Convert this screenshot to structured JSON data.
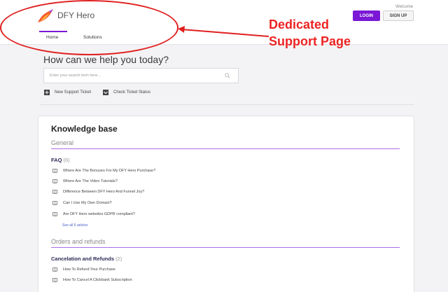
{
  "header": {
    "brand": "DFY Hero",
    "welcome": "Welcome",
    "login_label": "LOGIN",
    "signup_label": "SIGN UP",
    "tabs": [
      {
        "label": "Home",
        "active": true
      },
      {
        "label": "Solutions",
        "active": false
      }
    ]
  },
  "annotation": {
    "line1": "Dedicated",
    "line2": "Support Page",
    "color": "#ec2323"
  },
  "help": {
    "title": "How can we help you today?",
    "search_placeholder": "Enter your search term here...",
    "new_ticket_label": "New Support Ticket",
    "check_status_label": "Check Ticket Status"
  },
  "knowledge_base": {
    "title": "Knowledge base",
    "sections": [
      {
        "title": "General",
        "categories": [
          {
            "name": "FAQ",
            "count": "(6)",
            "articles": [
              "Where Are The Bonuses For My DFY Hero Purchase?",
              "Where Are The Video Tutorials?",
              "Difference Between DFY Hero And Funnel Joy?",
              "Can I Use My Own Domain?",
              "Are DFY Hero websites GDPR compliant?"
            ],
            "see_all": "See all 6 articles"
          }
        ]
      },
      {
        "title": "Orders and refunds",
        "categories": [
          {
            "name": "Cancelation and Refunds",
            "count": "(2)",
            "articles": [
              "How To Refund Your Purchase",
              "How To Cancel A Clickbank Subscription"
            ]
          }
        ]
      }
    ]
  },
  "colors": {
    "accent": "#7a18d6",
    "annotation_red": "#e02020",
    "section_line": "#b06be8"
  }
}
